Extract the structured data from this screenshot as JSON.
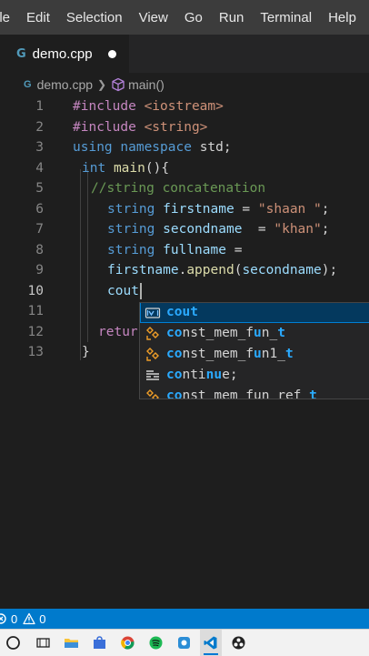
{
  "menu": {
    "items": [
      "ile",
      "Edit",
      "Selection",
      "View",
      "Go",
      "Run",
      "Terminal",
      "Help"
    ]
  },
  "tab": {
    "label": "demo.cpp",
    "icon": "cpp-file-icon"
  },
  "breadcrumb": {
    "file": "demo.cpp",
    "symbol": "main()"
  },
  "editor": {
    "lines": [
      {
        "n": "1",
        "tokens": [
          [
            "inc",
            "#include"
          ],
          [
            "plain",
            " "
          ],
          [
            "str",
            "<iostream>"
          ]
        ]
      },
      {
        "n": "2",
        "tokens": [
          [
            "inc",
            "#include"
          ],
          [
            "plain",
            " "
          ],
          [
            "str",
            "<string>"
          ]
        ]
      },
      {
        "n": "3",
        "tokens": [
          [
            "kw",
            "using"
          ],
          [
            "plain",
            " "
          ],
          [
            "kw",
            "namespace"
          ],
          [
            "plain",
            " std;"
          ]
        ]
      },
      {
        "n": "4",
        "tokens": [
          [
            "type",
            "int"
          ],
          [
            "plain",
            " "
          ],
          [
            "fn",
            "main"
          ],
          [
            "plain",
            "(){"
          ]
        ]
      },
      {
        "n": "5",
        "tokens": [
          [
            "comment",
            "//string concatenation"
          ]
        ]
      },
      {
        "n": "6",
        "tokens": [
          [
            "type",
            "string"
          ],
          [
            "plain",
            " "
          ],
          [
            "ident",
            "firstname"
          ],
          [
            "plain",
            " = "
          ],
          [
            "str",
            "\"shaan \""
          ],
          [
            "plain",
            ";"
          ]
        ]
      },
      {
        "n": "7",
        "tokens": [
          [
            "type",
            "string"
          ],
          [
            "plain",
            " "
          ],
          [
            "ident",
            "secondname"
          ],
          [
            "plain",
            "  = "
          ],
          [
            "str",
            "\"khan\""
          ],
          [
            "plain",
            ";"
          ]
        ]
      },
      {
        "n": "8",
        "tokens": [
          [
            "type",
            "string"
          ],
          [
            "plain",
            " "
          ],
          [
            "ident",
            "fullname"
          ],
          [
            "plain",
            " ="
          ]
        ]
      },
      {
        "n": "9",
        "tokens": [
          [
            "ident",
            "firstname"
          ],
          [
            "plain",
            "."
          ],
          [
            "fn",
            "append"
          ],
          [
            "plain",
            "("
          ],
          [
            "ident",
            "secondname"
          ],
          [
            "plain",
            ");"
          ]
        ]
      },
      {
        "n": "10",
        "tokens": [
          [
            "ident",
            "cout"
          ]
        ]
      },
      {
        "n": "11",
        "tokens": []
      },
      {
        "n": "12",
        "tokens": [
          [
            "inc",
            "retur"
          ]
        ]
      },
      {
        "n": "13",
        "tokens": [
          [
            "plain",
            "}"
          ]
        ]
      }
    ]
  },
  "suggestions": [
    {
      "kind": "variable-icon",
      "parts": [
        [
          "match",
          "cout"
        ]
      ]
    },
    {
      "kind": "class-icon",
      "parts": [
        [
          "match",
          "co"
        ],
        [
          "plain",
          "nst_mem_f"
        ],
        [
          "match",
          "u"
        ],
        [
          "plain",
          "n_"
        ],
        [
          "match",
          "t"
        ]
      ]
    },
    {
      "kind": "class-icon",
      "parts": [
        [
          "match",
          "co"
        ],
        [
          "plain",
          "nst_mem_f"
        ],
        [
          "match",
          "u"
        ],
        [
          "plain",
          "n1_"
        ],
        [
          "match",
          "t"
        ]
      ]
    },
    {
      "kind": "keyword-icon",
      "parts": [
        [
          "match",
          "co"
        ],
        [
          "plain",
          "nti"
        ],
        [
          "match",
          "nu"
        ],
        [
          "plain",
          "e;"
        ]
      ]
    },
    {
      "kind": "class-icon",
      "parts": [
        [
          "match",
          "co"
        ],
        [
          "plain",
          "nst_mem_fun_ref_"
        ],
        [
          "match",
          "t"
        ]
      ]
    }
  ],
  "status": {
    "errors": "0",
    "warnings": "0"
  },
  "colors": {
    "accent": "#007acc",
    "menubar": "#3c3c3c",
    "editor_bg": "#1e1e1e"
  }
}
